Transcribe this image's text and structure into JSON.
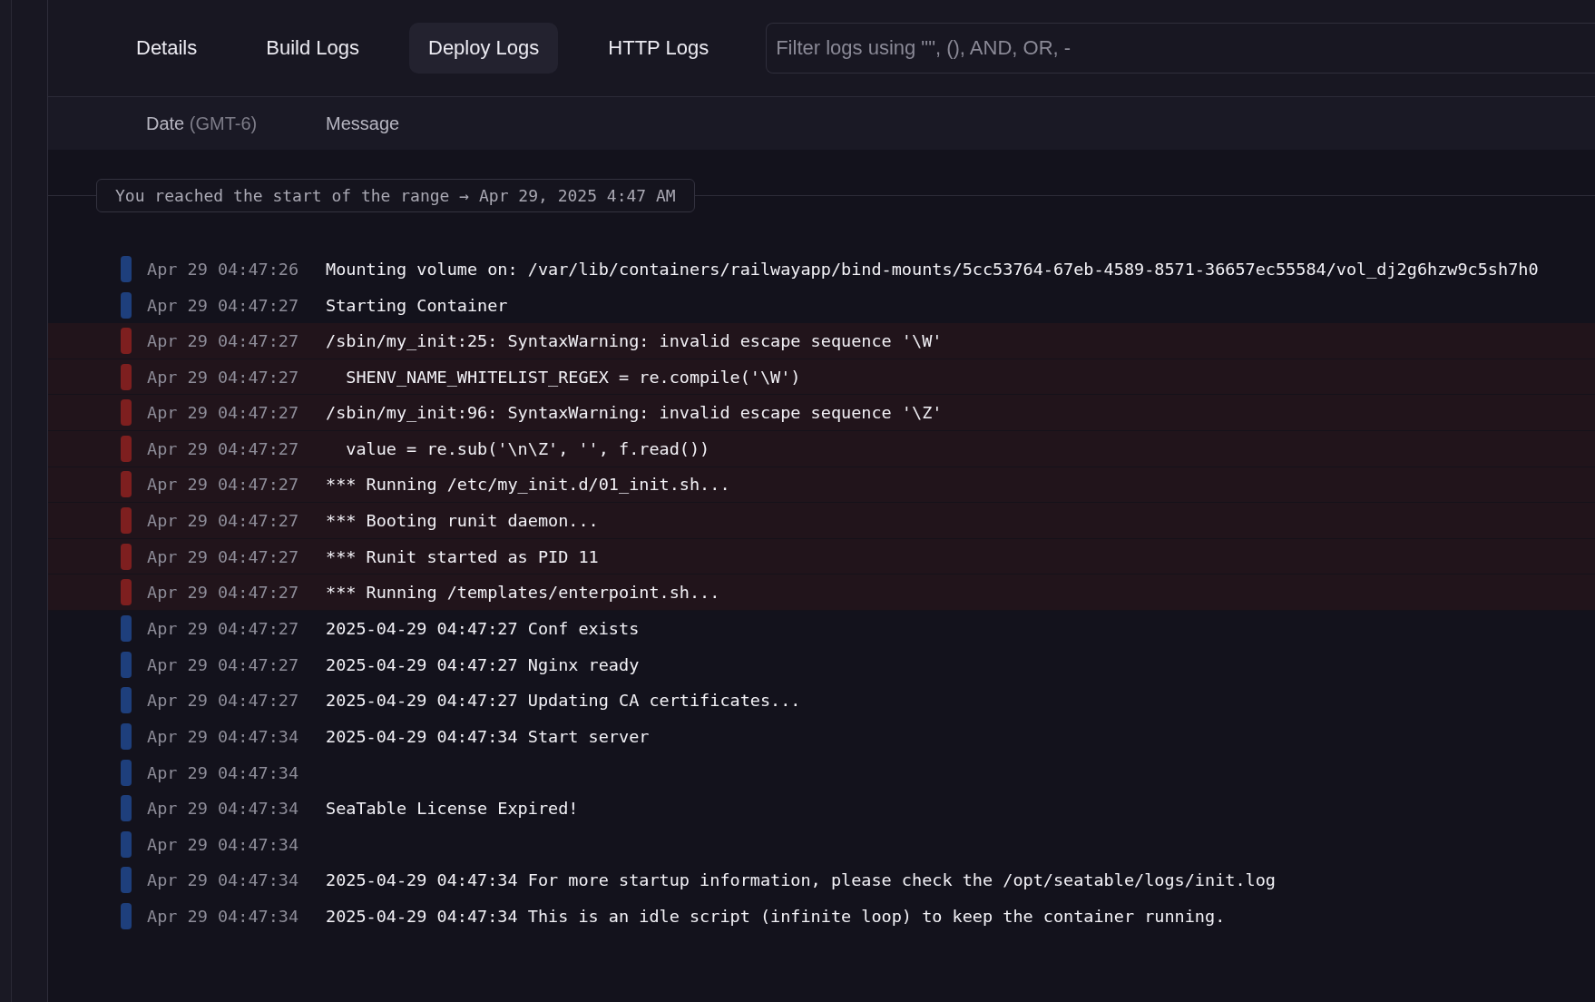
{
  "tabs": [
    {
      "label": "Details",
      "selected": false
    },
    {
      "label": "Build Logs",
      "selected": false
    },
    {
      "label": "Deploy Logs",
      "selected": true
    },
    {
      "label": "HTTP Logs",
      "selected": false
    }
  ],
  "filter": {
    "placeholder": "Filter logs using \"\", (), AND, OR, -"
  },
  "columns": {
    "date": "Date",
    "timezone": "(GMT-6)",
    "message": "Message"
  },
  "range_notice": "You reached the start of the range → Apr 29, 2025 4:47 AM",
  "logs": [
    {
      "kind": "info",
      "time": "Apr 29 04:47:26",
      "message": "Mounting volume on: /var/lib/containers/railwayapp/bind-mounts/5cc53764-67eb-4589-8571-36657ec55584/vol_dj2g6hzw9c5sh7h0"
    },
    {
      "kind": "info",
      "time": "Apr 29 04:47:27",
      "message": "Starting Container"
    },
    {
      "kind": "error",
      "time": "Apr 29 04:47:27",
      "message": "/sbin/my_init:25: SyntaxWarning: invalid escape sequence '\\W'"
    },
    {
      "kind": "error",
      "time": "Apr 29 04:47:27",
      "message": "  SHENV_NAME_WHITELIST_REGEX = re.compile('\\W')"
    },
    {
      "kind": "error",
      "time": "Apr 29 04:47:27",
      "message": "/sbin/my_init:96: SyntaxWarning: invalid escape sequence '\\Z'"
    },
    {
      "kind": "error",
      "time": "Apr 29 04:47:27",
      "message": "  value = re.sub('\\n\\Z', '', f.read())"
    },
    {
      "kind": "error",
      "time": "Apr 29 04:47:27",
      "message": "*** Running /etc/my_init.d/01_init.sh..."
    },
    {
      "kind": "error",
      "time": "Apr 29 04:47:27",
      "message": "*** Booting runit daemon..."
    },
    {
      "kind": "error",
      "time": "Apr 29 04:47:27",
      "message": "*** Runit started as PID 11"
    },
    {
      "kind": "error",
      "time": "Apr 29 04:47:27",
      "message": "*** Running /templates/enterpoint.sh..."
    },
    {
      "kind": "info",
      "time": "Apr 29 04:47:27",
      "message": "2025-04-29 04:47:27 Conf exists"
    },
    {
      "kind": "info",
      "time": "Apr 29 04:47:27",
      "message": "2025-04-29 04:47:27 Nginx ready"
    },
    {
      "kind": "info",
      "time": "Apr 29 04:47:27",
      "message": "2025-04-29 04:47:27 Updating CA certificates..."
    },
    {
      "kind": "info",
      "time": "Apr 29 04:47:34",
      "message": "2025-04-29 04:47:34 Start server"
    },
    {
      "kind": "info",
      "time": "Apr 29 04:47:34"
    },
    {
      "kind": "info",
      "time": "Apr 29 04:47:34",
      "message": "SeaTable License Expired!"
    },
    {
      "kind": "info",
      "time": "Apr 29 04:47:34"
    },
    {
      "kind": "info",
      "time": "Apr 29 04:47:34",
      "message": "2025-04-29 04:47:34 For more startup information, please check the /opt/seatable/logs/init.log"
    },
    {
      "kind": "info",
      "time": "Apr 29 04:47:34",
      "message": "2025-04-29 04:47:34 This is an idle script (infinite loop) to keep the container running."
    }
  ]
}
